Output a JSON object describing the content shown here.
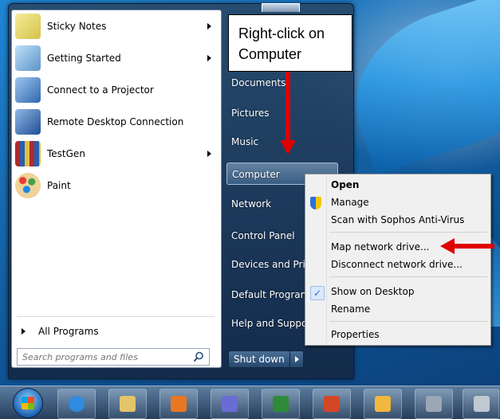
{
  "start_menu": {
    "programs": [
      {
        "label": "Sticky Notes",
        "icon": "sticky-notes-icon",
        "has_submenu": true,
        "icon_color": "#e8d86a"
      },
      {
        "label": "Getting Started",
        "icon": "getting-started-icon",
        "has_submenu": true,
        "icon_color": "#7fb2e0"
      },
      {
        "label": "Connect to a Projector",
        "icon": "projector-icon",
        "has_submenu": false,
        "icon_color": "#5a8fd0"
      },
      {
        "label": "Remote Desktop Connection",
        "icon": "remote-desktop-icon",
        "has_submenu": false,
        "icon_color": "#3a6fb8"
      },
      {
        "label": "TestGen",
        "icon": "testgen-icon",
        "has_submenu": true,
        "icon_color": "#b02a2a"
      },
      {
        "label": "Paint",
        "icon": "paint-icon",
        "has_submenu": false,
        "icon_color": "#d9a441"
      }
    ],
    "all_programs": "All Programs",
    "search_placeholder": "Search programs and files",
    "right_items": [
      "Documents",
      "Pictures",
      "Music",
      "Computer",
      "Network",
      "Control Panel",
      "Devices and Pri",
      "Default Progran",
      "Help and Suppc"
    ],
    "highlighted_item": "Computer",
    "shutdown": "Shut down"
  },
  "callout": {
    "line1": "Right-click on",
    "line2": "Computer"
  },
  "context_menu": {
    "items": [
      "Open",
      "Manage",
      "Scan with Sophos Anti-Virus",
      "Map network drive...",
      "Disconnect network drive...",
      "Show on Desktop",
      "Rename",
      "Properties"
    ],
    "bold_item": "Open",
    "checked_item": "Show on Desktop"
  },
  "taskbar": {
    "buttons": [
      {
        "icon": "internet-explorer-icon",
        "color": "#2f8ae0"
      },
      {
        "icon": "file-explorer-icon",
        "color": "#e3c46a"
      },
      {
        "icon": "media-player-icon",
        "color": "#e87722"
      },
      {
        "icon": "visio-icon",
        "color": "#6b6bd6"
      },
      {
        "icon": "excel-icon",
        "color": "#2e8b3a"
      },
      {
        "icon": "powerpoint-icon",
        "color": "#d24726"
      },
      {
        "icon": "outlook-icon",
        "color": "#f0b83c"
      },
      {
        "icon": "calculator-icon",
        "color": "#9aa7b5"
      },
      {
        "icon": "snipping-tool-icon",
        "color": "#c0c8d0"
      }
    ]
  },
  "colors": {
    "annotation_arrow": "#e00000"
  }
}
